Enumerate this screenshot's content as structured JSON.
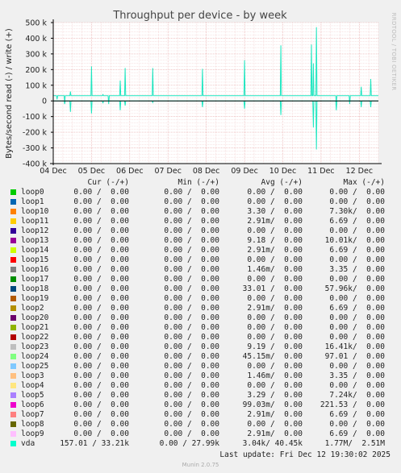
{
  "chart_data": {
    "type": "line",
    "title": "Throughput per device - by week",
    "ylabel": "Bytes/second read (-) / write (+)",
    "side_label": "RRDTOOL / TOBI OETIKER",
    "ylim": [
      -400000,
      500000
    ],
    "y_ticks": [
      500000,
      400000,
      300000,
      200000,
      100000,
      0,
      -100000,
      -200000,
      -300000,
      -400000
    ],
    "y_tick_labels": [
      "500 k",
      "400 k",
      "300 k",
      "200 k",
      "100 k",
      "0",
      "-100 k",
      "-200 k",
      "-300 k",
      "-400 k"
    ],
    "x_range_days": [
      0,
      8.5
    ],
    "x_ticks": [
      "04 Dec",
      "05 Dec",
      "06 Dec",
      "07 Dec",
      "08 Dec",
      "09 Dec",
      "10 Dec",
      "11 Dec",
      "12 Dec"
    ],
    "grid": true,
    "series": [
      {
        "name": "vda",
        "color": "#1ee6c0",
        "baseline_write": 33210,
        "baseline_read": -157,
        "spikes_write": [
          [
            0.1,
            10000
          ],
          [
            0.3,
            -8000
          ],
          [
            0.45,
            60000
          ],
          [
            1.0,
            220000
          ],
          [
            1.3,
            40000
          ],
          [
            1.45,
            -20000
          ],
          [
            1.75,
            130000
          ],
          [
            1.88,
            210000
          ],
          [
            2.6,
            210000
          ],
          [
            3.9,
            205000
          ],
          [
            5.0,
            260000
          ],
          [
            5.95,
            355000
          ],
          [
            6.75,
            360000
          ],
          [
            6.8,
            240000
          ],
          [
            6.88,
            470000
          ],
          [
            7.4,
            -10000
          ],
          [
            7.75,
            -20000
          ],
          [
            8.05,
            90000
          ],
          [
            8.3,
            140000
          ]
        ],
        "spikes_read": [
          [
            0.3,
            -20000
          ],
          [
            0.45,
            -70000
          ],
          [
            1.0,
            -80000
          ],
          [
            1.3,
            -15000
          ],
          [
            1.75,
            -60000
          ],
          [
            1.88,
            -30000
          ],
          [
            2.6,
            -10000
          ],
          [
            3.9,
            -40000
          ],
          [
            5.0,
            -50000
          ],
          [
            5.95,
            -90000
          ],
          [
            6.8,
            -170000
          ],
          [
            6.88,
            -310000
          ],
          [
            7.4,
            -60000
          ],
          [
            8.05,
            -40000
          ],
          [
            8.3,
            -40000
          ]
        ]
      }
    ]
  },
  "legend": {
    "headers": [
      "Cur (-/+)",
      "Min (-/+)",
      "Avg (-/+)",
      "Max (-/+)"
    ],
    "rows": [
      {
        "name": "loop0",
        "color": "#00cc00",
        "cur": "0.00 /  0.00",
        "min": "0.00 /  0.00",
        "avg": "0.00 /  0.00",
        "max": "0.00 /  0.00"
      },
      {
        "name": "loop1",
        "color": "#0066b3",
        "cur": "0.00 /  0.00",
        "min": "0.00 /  0.00",
        "avg": "0.00 /  0.00",
        "max": "0.00 /  0.00"
      },
      {
        "name": "loop10",
        "color": "#ff8000",
        "cur": "0.00 /  0.00",
        "min": "0.00 /  0.00",
        "avg": "3.30 /  0.00",
        "max": "7.30k/  0.00"
      },
      {
        "name": "loop11",
        "color": "#ffcc00",
        "cur": "0.00 /  0.00",
        "min": "0.00 /  0.00",
        "avg": "2.91m/  0.00",
        "max": "6.69 /  0.00"
      },
      {
        "name": "loop12",
        "color": "#330099",
        "cur": "0.00 /  0.00",
        "min": "0.00 /  0.00",
        "avg": "0.00 /  0.00",
        "max": "0.00 /  0.00"
      },
      {
        "name": "loop13",
        "color": "#990099",
        "cur": "0.00 /  0.00",
        "min": "0.00 /  0.00",
        "avg": "9.18 /  0.00",
        "max": "10.01k/  0.00"
      },
      {
        "name": "loop14",
        "color": "#ccff00",
        "cur": "0.00 /  0.00",
        "min": "0.00 /  0.00",
        "avg": "2.91m/  0.00",
        "max": "6.69 /  0.00"
      },
      {
        "name": "loop15",
        "color": "#ff0000",
        "cur": "0.00 /  0.00",
        "min": "0.00 /  0.00",
        "avg": "0.00 /  0.00",
        "max": "0.00 /  0.00"
      },
      {
        "name": "loop16",
        "color": "#808080",
        "cur": "0.00 /  0.00",
        "min": "0.00 /  0.00",
        "avg": "1.46m/  0.00",
        "max": "3.35 /  0.00"
      },
      {
        "name": "loop17",
        "color": "#008f00",
        "cur": "0.00 /  0.00",
        "min": "0.00 /  0.00",
        "avg": "0.00 /  0.00",
        "max": "0.00 /  0.00"
      },
      {
        "name": "loop18",
        "color": "#00487d",
        "cur": "0.00 /  0.00",
        "min": "0.00 /  0.00",
        "avg": "33.01 /  0.00",
        "max": "57.96k/  0.00"
      },
      {
        "name": "loop19",
        "color": "#b35a00",
        "cur": "0.00 /  0.00",
        "min": "0.00 /  0.00",
        "avg": "0.00 /  0.00",
        "max": "0.00 /  0.00"
      },
      {
        "name": "loop2",
        "color": "#b38f00",
        "cur": "0.00 /  0.00",
        "min": "0.00 /  0.00",
        "avg": "2.91m/  0.00",
        "max": "6.69 /  0.00"
      },
      {
        "name": "loop20",
        "color": "#6b006b",
        "cur": "0.00 /  0.00",
        "min": "0.00 /  0.00",
        "avg": "0.00 /  0.00",
        "max": "0.00 /  0.00"
      },
      {
        "name": "loop21",
        "color": "#8fb300",
        "cur": "0.00 /  0.00",
        "min": "0.00 /  0.00",
        "avg": "0.00 /  0.00",
        "max": "0.00 /  0.00"
      },
      {
        "name": "loop22",
        "color": "#b30000",
        "cur": "0.00 /  0.00",
        "min": "0.00 /  0.00",
        "avg": "0.00 /  0.00",
        "max": "0.00 /  0.00"
      },
      {
        "name": "loop23",
        "color": "#bebebe",
        "cur": "0.00 /  0.00",
        "min": "0.00 /  0.00",
        "avg": "9.19 /  0.00",
        "max": "16.41k/  0.00"
      },
      {
        "name": "loop24",
        "color": "#80ff80",
        "cur": "0.00 /  0.00",
        "min": "0.00 /  0.00",
        "avg": "45.15m/  0.00",
        "max": "97.01 /  0.00"
      },
      {
        "name": "loop25",
        "color": "#80c9ff",
        "cur": "0.00 /  0.00",
        "min": "0.00 /  0.00",
        "avg": "0.00 /  0.00",
        "max": "0.00 /  0.00"
      },
      {
        "name": "loop3",
        "color": "#ffc080",
        "cur": "0.00 /  0.00",
        "min": "0.00 /  0.00",
        "avg": "1.46m/  0.00",
        "max": "3.35 /  0.00"
      },
      {
        "name": "loop4",
        "color": "#ffe680",
        "cur": "0.00 /  0.00",
        "min": "0.00 /  0.00",
        "avg": "0.00 /  0.00",
        "max": "0.00 /  0.00"
      },
      {
        "name": "loop5",
        "color": "#aa80ff",
        "cur": "0.00 /  0.00",
        "min": "0.00 /  0.00",
        "avg": "3.29 /  0.00",
        "max": "7.24k/  0.00"
      },
      {
        "name": "loop6",
        "color": "#ee00cc",
        "cur": "0.00 /  0.00",
        "min": "0.00 /  0.00",
        "avg": "99.03m/  0.00",
        "max": "221.53 /  0.00"
      },
      {
        "name": "loop7",
        "color": "#ff8080",
        "cur": "0.00 /  0.00",
        "min": "0.00 /  0.00",
        "avg": "2.91m/  0.00",
        "max": "6.69 /  0.00"
      },
      {
        "name": "loop8",
        "color": "#666600",
        "cur": "0.00 /  0.00",
        "min": "0.00 /  0.00",
        "avg": "0.00 /  0.00",
        "max": "0.00 /  0.00"
      },
      {
        "name": "loop9",
        "color": "#ffbfff",
        "cur": "0.00 /  0.00",
        "min": "0.00 /  0.00",
        "avg": "2.91m/  0.00",
        "max": "6.69 /  0.00"
      },
      {
        "name": "vda",
        "color": "#00ffcc",
        "cur": "157.01 / 33.21k",
        "min": "0.00 / 27.99k",
        "avg": "3.04k/ 40.45k",
        "max": "1.77M/  2.51M"
      }
    ]
  },
  "footer": {
    "last_update": "Last update: Fri Dec 12 19:30:02 2025",
    "version": "Munin 2.0.75"
  }
}
